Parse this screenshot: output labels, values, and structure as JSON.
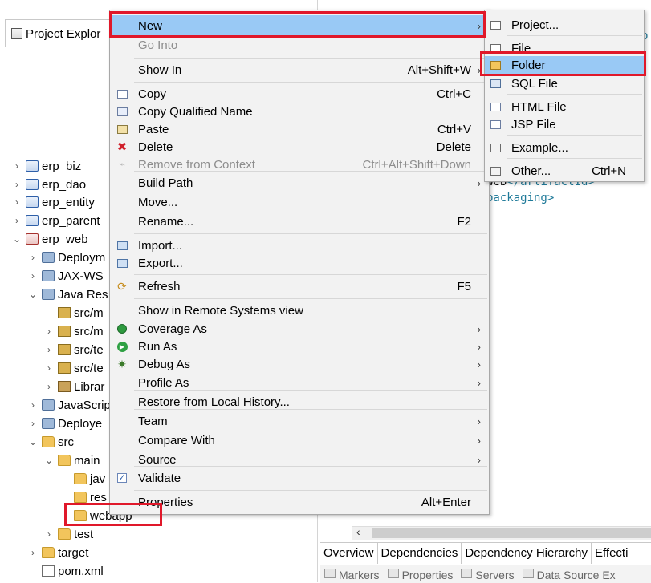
{
  "explorer": {
    "tab_title": "Project Explor",
    "tree": [
      {
        "label": "erp_biz",
        "twisty": "›",
        "icon": "maven-project-icon"
      },
      {
        "label": "erp_dao",
        "twisty": "›",
        "icon": "maven-project-icon"
      },
      {
        "label": "erp_entity",
        "twisty": "›",
        "icon": "maven-project-icon"
      },
      {
        "label": "erp_parent",
        "twisty": "›",
        "icon": "maven-project-icon"
      },
      {
        "label": "erp_web",
        "twisty": "⌄",
        "icon": "web-project-icon"
      },
      {
        "label": "Deploym",
        "twisty": "›",
        "icon": "deployment-descriptor-icon"
      },
      {
        "label": "JAX-WS",
        "twisty": "›",
        "icon": "jaxws-icon"
      },
      {
        "label": "Java Res",
        "twisty": "⌄",
        "icon": "java-resources-icon"
      },
      {
        "label": "src/m",
        "twisty": "",
        "icon": "source-folder-icon"
      },
      {
        "label": "src/m",
        "twisty": "›",
        "icon": "source-folder-icon"
      },
      {
        "label": "src/te",
        "twisty": "›",
        "icon": "source-folder-icon"
      },
      {
        "label": "src/te",
        "twisty": "›",
        "icon": "source-folder-icon"
      },
      {
        "label": "Librar",
        "twisty": "›",
        "icon": "library-icon"
      },
      {
        "label": "JavaScrip",
        "twisty": "›",
        "icon": "javascript-icon"
      },
      {
        "label": "Deploye",
        "twisty": "›",
        "icon": "deployed-resources-icon"
      },
      {
        "label": "src",
        "twisty": "⌄",
        "icon": "folder-icon"
      },
      {
        "label": "main",
        "twisty": "⌄",
        "icon": "folder-icon"
      },
      {
        "label": "jav",
        "twisty": "",
        "icon": "folder-icon"
      },
      {
        "label": "res",
        "twisty": "",
        "icon": "folder-icon"
      },
      {
        "label": "webapp",
        "twisty": "",
        "icon": "folder-icon"
      },
      {
        "label": "test",
        "twisty": "›",
        "icon": "folder-icon"
      },
      {
        "label": "target",
        "twisty": "›",
        "icon": "folder-icon"
      },
      {
        "label": "pom.xml",
        "twisty": "",
        "icon": "pom-file-icon"
      }
    ]
  },
  "editor": {
    "code_lines": [
      {
        "pre": "",
        "tag": "p"
      },
      {
        "pre": "web",
        "tag": "</artifactId>"
      },
      {
        "pre": "",
        "tag": "packaging>"
      }
    ],
    "bottom_tabs": [
      "Overview",
      "Dependencies",
      "Dependency Hierarchy",
      "Effecti"
    ],
    "view_tabs": [
      "Markers",
      "Properties",
      "Servers",
      "Data Source Ex"
    ]
  },
  "context_menu": {
    "items": [
      {
        "label": "New",
        "accel": "",
        "submenu": true,
        "icon": "",
        "state": "highlighted"
      },
      {
        "label": "Go Into",
        "accel": "",
        "submenu": false,
        "icon": "",
        "state": "disabled"
      },
      {
        "label": "Show In",
        "accel": "Alt+Shift+W",
        "submenu": true,
        "icon": "",
        "state": "normal"
      },
      {
        "label": "Copy",
        "accel": "Ctrl+C",
        "submenu": false,
        "icon": "copy-icon",
        "state": "normal"
      },
      {
        "label": "Copy Qualified Name",
        "accel": "",
        "submenu": false,
        "icon": "copy-qualified-icon",
        "state": "normal"
      },
      {
        "label": "Paste",
        "accel": "Ctrl+V",
        "submenu": false,
        "icon": "paste-icon",
        "state": "normal"
      },
      {
        "label": "Delete",
        "accel": "Delete",
        "submenu": false,
        "icon": "delete-icon",
        "state": "normal"
      },
      {
        "label": "Remove from Context",
        "accel": "Ctrl+Alt+Shift+Down",
        "submenu": false,
        "icon": "remove-context-icon",
        "state": "disabled"
      },
      {
        "label": "Build Path",
        "accel": "",
        "submenu": true,
        "icon": "",
        "state": "normal"
      },
      {
        "label": "Move...",
        "accel": "",
        "submenu": false,
        "icon": "",
        "state": "normal"
      },
      {
        "label": "Rename...",
        "accel": "F2",
        "submenu": false,
        "icon": "",
        "state": "normal"
      },
      {
        "label": "Import...",
        "accel": "",
        "submenu": false,
        "icon": "import-icon",
        "state": "normal"
      },
      {
        "label": "Export...",
        "accel": "",
        "submenu": false,
        "icon": "export-icon",
        "state": "normal"
      },
      {
        "label": "Refresh",
        "accel": "F5",
        "submenu": false,
        "icon": "refresh-icon",
        "state": "normal"
      },
      {
        "label": "Show in Remote Systems view",
        "accel": "",
        "submenu": false,
        "icon": "",
        "state": "normal"
      },
      {
        "label": "Coverage As",
        "accel": "",
        "submenu": true,
        "icon": "coverage-icon",
        "state": "normal"
      },
      {
        "label": "Run As",
        "accel": "",
        "submenu": true,
        "icon": "run-icon",
        "state": "normal"
      },
      {
        "label": "Debug As",
        "accel": "",
        "submenu": true,
        "icon": "debug-icon",
        "state": "normal"
      },
      {
        "label": "Profile As",
        "accel": "",
        "submenu": true,
        "icon": "",
        "state": "normal"
      },
      {
        "label": "Restore from Local History...",
        "accel": "",
        "submenu": false,
        "icon": "",
        "state": "normal"
      },
      {
        "label": "Team",
        "accel": "",
        "submenu": true,
        "icon": "",
        "state": "normal"
      },
      {
        "label": "Compare With",
        "accel": "",
        "submenu": true,
        "icon": "",
        "state": "normal"
      },
      {
        "label": "Source",
        "accel": "",
        "submenu": true,
        "icon": "",
        "state": "normal"
      },
      {
        "label": "Validate",
        "accel": "",
        "submenu": false,
        "icon": "validate-check-icon",
        "state": "normal"
      },
      {
        "label": "Properties",
        "accel": "Alt+Enter",
        "submenu": false,
        "icon": "",
        "state": "normal"
      }
    ]
  },
  "new_submenu": {
    "items": [
      {
        "label": "Project...",
        "accel": "",
        "icon": "new-project-icon",
        "state": "normal"
      },
      {
        "label": "File",
        "accel": "",
        "icon": "new-file-icon",
        "state": "normal"
      },
      {
        "label": "Folder",
        "accel": "",
        "icon": "new-folder-icon",
        "state": "highlighted"
      },
      {
        "label": "SQL File",
        "accel": "",
        "icon": "sql-file-icon",
        "state": "normal"
      },
      {
        "label": "HTML File",
        "accel": "",
        "icon": "html-file-icon",
        "state": "normal"
      },
      {
        "label": "JSP File",
        "accel": "",
        "icon": "jsp-file-icon",
        "state": "normal"
      },
      {
        "label": "Example...",
        "accel": "",
        "icon": "example-icon",
        "state": "normal"
      },
      {
        "label": "Other...",
        "accel": "Ctrl+N",
        "icon": "other-wizard-icon",
        "state": "normal"
      }
    ]
  },
  "colors": {
    "highlight": "#99c9f5",
    "annotation_red": "#e0182a",
    "menu_bg": "#f2f2f2",
    "code_tag": "#1f7a99"
  }
}
